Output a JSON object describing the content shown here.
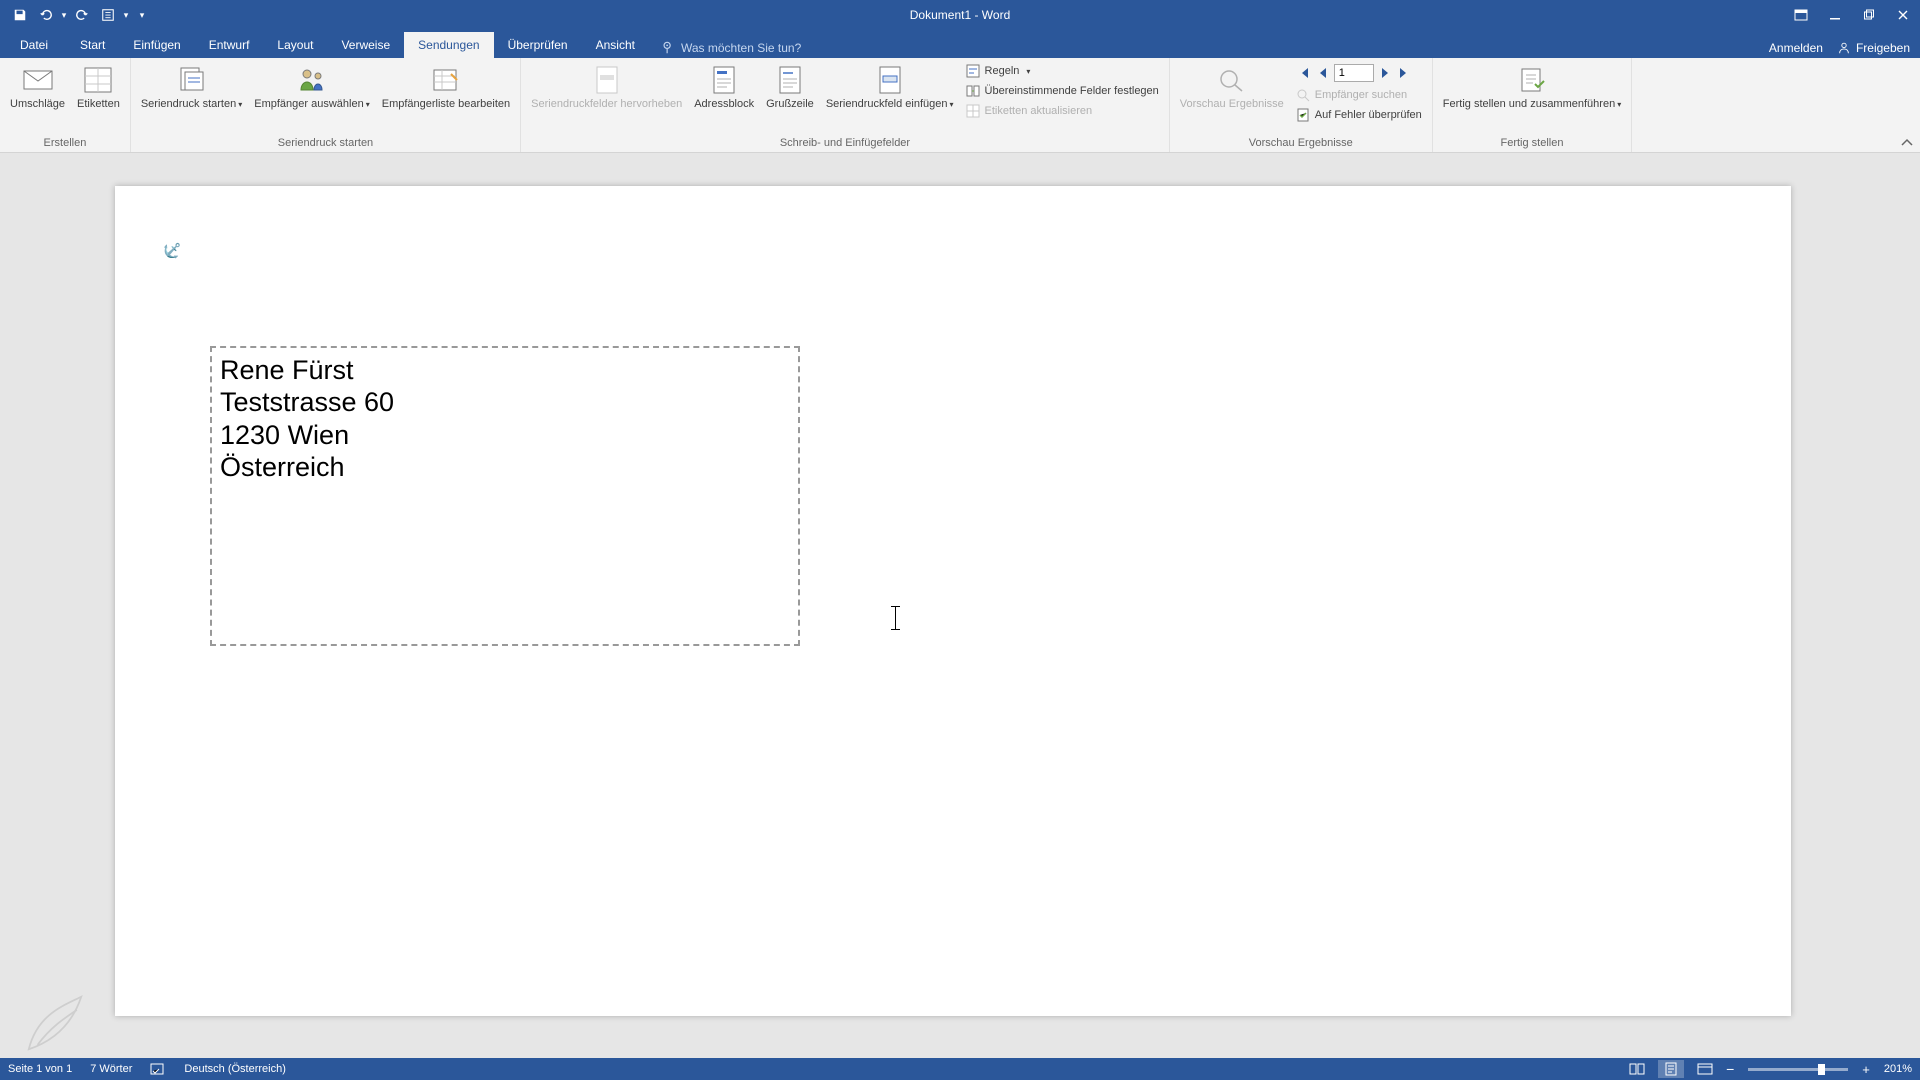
{
  "title": "Dokument1 - Word",
  "qat": {
    "customize_tip": "▾"
  },
  "window": {
    "account": "Anmelden",
    "share": "Freigeben"
  },
  "tabs": {
    "file": "Datei",
    "home": "Start",
    "insert": "Einfügen",
    "design": "Entwurf",
    "layout": "Layout",
    "references": "Verweise",
    "mailings": "Sendungen",
    "review": "Überprüfen",
    "view": "Ansicht"
  },
  "tell_me": "Was möchten Sie tun?",
  "ribbon": {
    "group_create": "Erstellen",
    "envelopes": "Umschläge",
    "labels": "Etiketten",
    "group_start": "Seriendruck starten",
    "start_merge": "Seriendruck starten",
    "select_recipients": "Empfänger auswählen",
    "edit_recipients": "Empfängerliste bearbeiten",
    "group_fields": "Schreib- und Einfügefelder",
    "highlight_fields": "Seriendruckfelder hervorheben",
    "address_block": "Adressblock",
    "greeting_line": "Grußzeile",
    "insert_merge_field": "Seriendruckfeld einfügen",
    "rules": "Regeln",
    "match_fields": "Übereinstimmende Felder festlegen",
    "update_labels": "Etiketten aktualisieren",
    "group_preview": "Vorschau Ergebnisse",
    "preview_results": "Vorschau Ergebnisse",
    "record_number": "1",
    "find_recipient": "Empfänger suchen",
    "check_errors": "Auf Fehler überprüfen",
    "group_finish": "Fertig stellen",
    "finish_merge": "Fertig stellen und zusammenführen"
  },
  "document": {
    "line1": "Rene Fürst",
    "line2": "Teststrasse 60",
    "line3": "1230 Wien",
    "line4": "Österreich"
  },
  "status": {
    "page": "Seite 1 von 1",
    "words": "7 Wörter",
    "language": "Deutsch (Österreich)",
    "zoom": "201%"
  }
}
